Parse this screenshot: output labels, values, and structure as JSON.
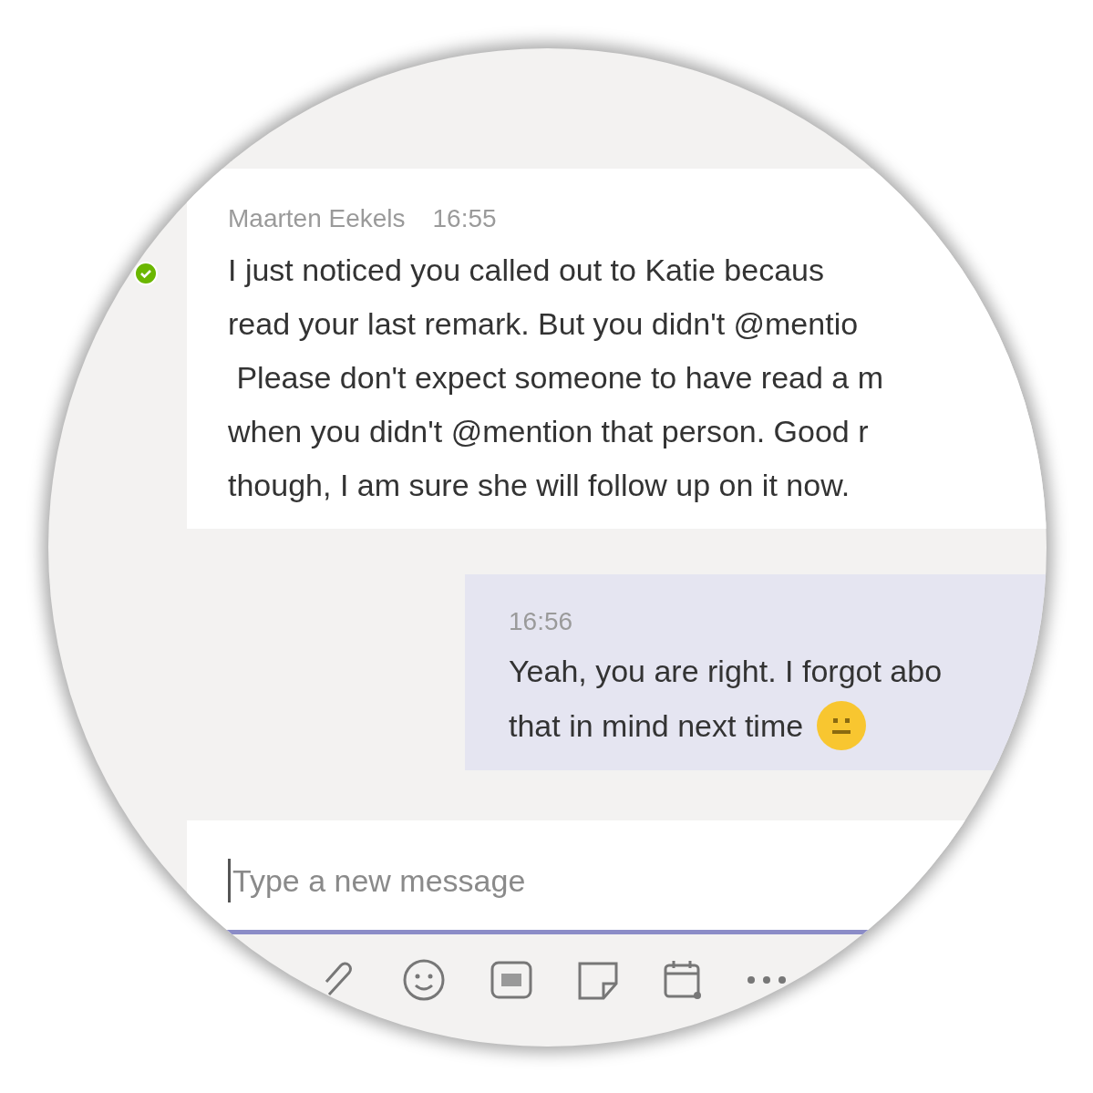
{
  "message": {
    "author": "Maarten Eekels",
    "time": "16:55",
    "lines": [
      "I just noticed you called out to Katie becaus",
      "read your last remark. But you didn't @mentio",
      " Please don't expect someone to have read a m",
      "when you didn't @mention that person. Good r",
      "though, I am sure she will follow up on it now."
    ]
  },
  "reply": {
    "time": "16:56",
    "lines": [
      "Yeah, you are right. I forgot abo",
      "that in mind next time"
    ]
  },
  "compose": {
    "placeholder": "Type a new message"
  }
}
